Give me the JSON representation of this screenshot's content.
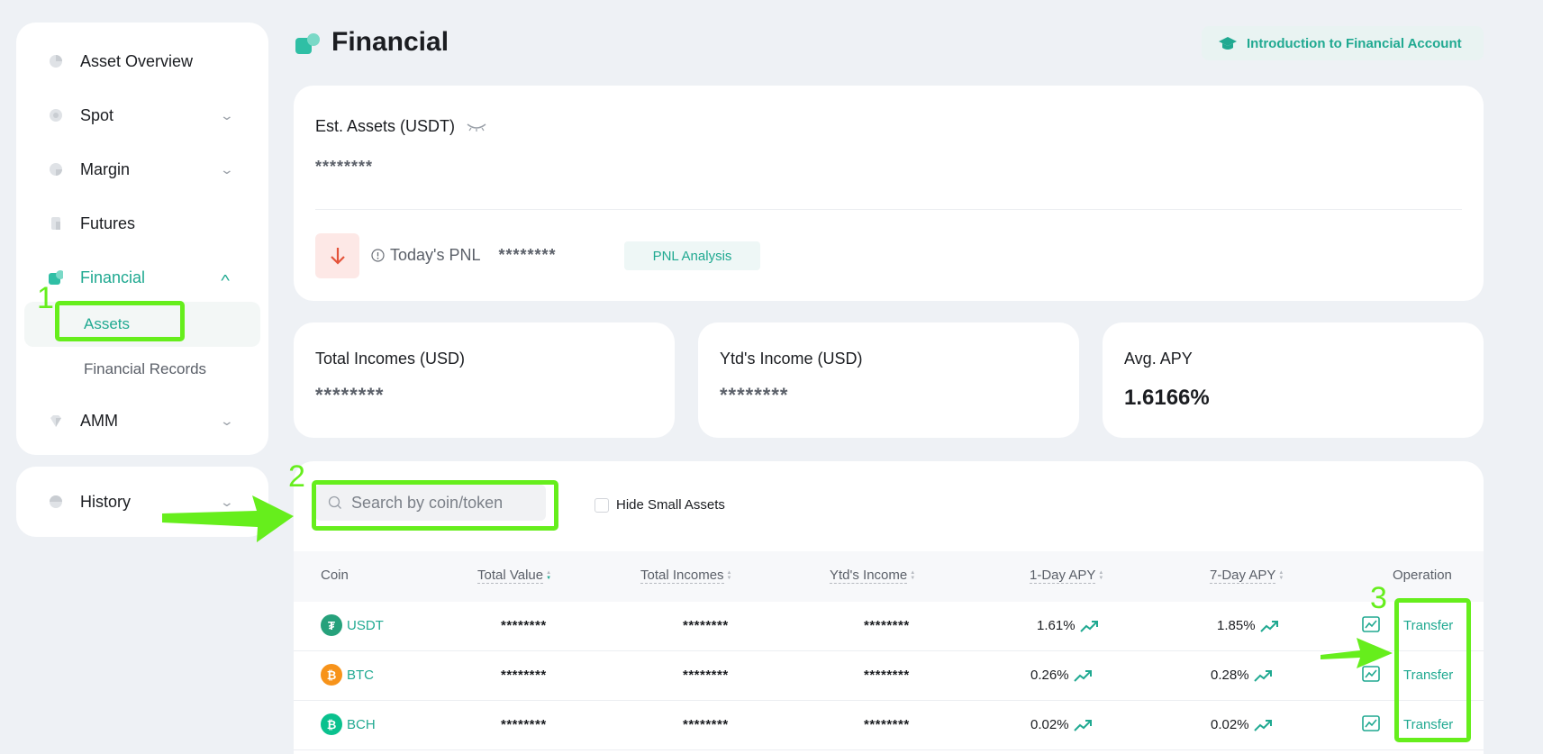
{
  "sidebar": {
    "items": [
      {
        "label": "Asset Overview",
        "icon": "pie-chart-icon"
      },
      {
        "label": "Spot",
        "icon": "gear-coin-icon"
      },
      {
        "label": "Margin",
        "icon": "margin-icon"
      },
      {
        "label": "Futures",
        "icon": "futures-icon"
      },
      {
        "label": "Financial",
        "icon": "financial-icon"
      },
      {
        "label": "AMM",
        "icon": "diamond-icon"
      }
    ],
    "sub_items": [
      {
        "label": "Assets"
      },
      {
        "label": "Financial Records"
      }
    ],
    "history": {
      "label": "History",
      "icon": "history-icon"
    }
  },
  "header": {
    "title": "Financial",
    "intro_button": "Introduction to Financial Account"
  },
  "est_assets": {
    "label": "Est. Assets (USDT)",
    "value": "********",
    "todays_pnl_label": "Today's PNL",
    "todays_pnl_value": "********",
    "pnl_button": "PNL Analysis"
  },
  "stats": {
    "total_incomes_label": "Total Incomes (USD)",
    "total_incomes_value": "********",
    "ytd_income_label": "Ytd's Income (USD)",
    "ytd_income_value": "********",
    "avg_apy_label": "Avg. APY",
    "avg_apy_value": "1.6166%"
  },
  "filters": {
    "search_placeholder": "Search by coin/token",
    "hide_small_label": "Hide Small Assets"
  },
  "table": {
    "headers": {
      "coin": "Coin",
      "total_value": "Total Value",
      "total_incomes": "Total Incomes",
      "ytd_income": "Ytd's Income",
      "one_day_apy": "1-Day APY",
      "seven_day_apy": "7-Day APY",
      "operation": "Operation"
    },
    "rows": [
      {
        "coin": "USDT",
        "logo_letter": "₮",
        "logo_color": "#26a17b",
        "total_value": "********",
        "total_incomes": "********",
        "ytd_income": "********",
        "one_day_apy": "1.61%",
        "seven_day_apy": "1.85%",
        "action": "Transfer"
      },
      {
        "coin": "BTC",
        "logo_letter": "₿",
        "logo_color": "#f7931a",
        "total_value": "********",
        "total_incomes": "********",
        "ytd_income": "********",
        "one_day_apy": "0.26%",
        "seven_day_apy": "0.28%",
        "action": "Transfer"
      },
      {
        "coin": "BCH",
        "logo_letter": "₿",
        "logo_color": "#0ac18e",
        "total_value": "********",
        "total_incomes": "********",
        "ytd_income": "********",
        "one_day_apy": "0.02%",
        "seven_day_apy": "0.02%",
        "action": "Transfer"
      }
    ]
  },
  "annotations": {
    "labels": [
      "1",
      "2",
      "3"
    ]
  },
  "colors": {
    "accent": "#20a991",
    "annotation": "#66ee1c",
    "pnl_down": "#e4533a"
  }
}
